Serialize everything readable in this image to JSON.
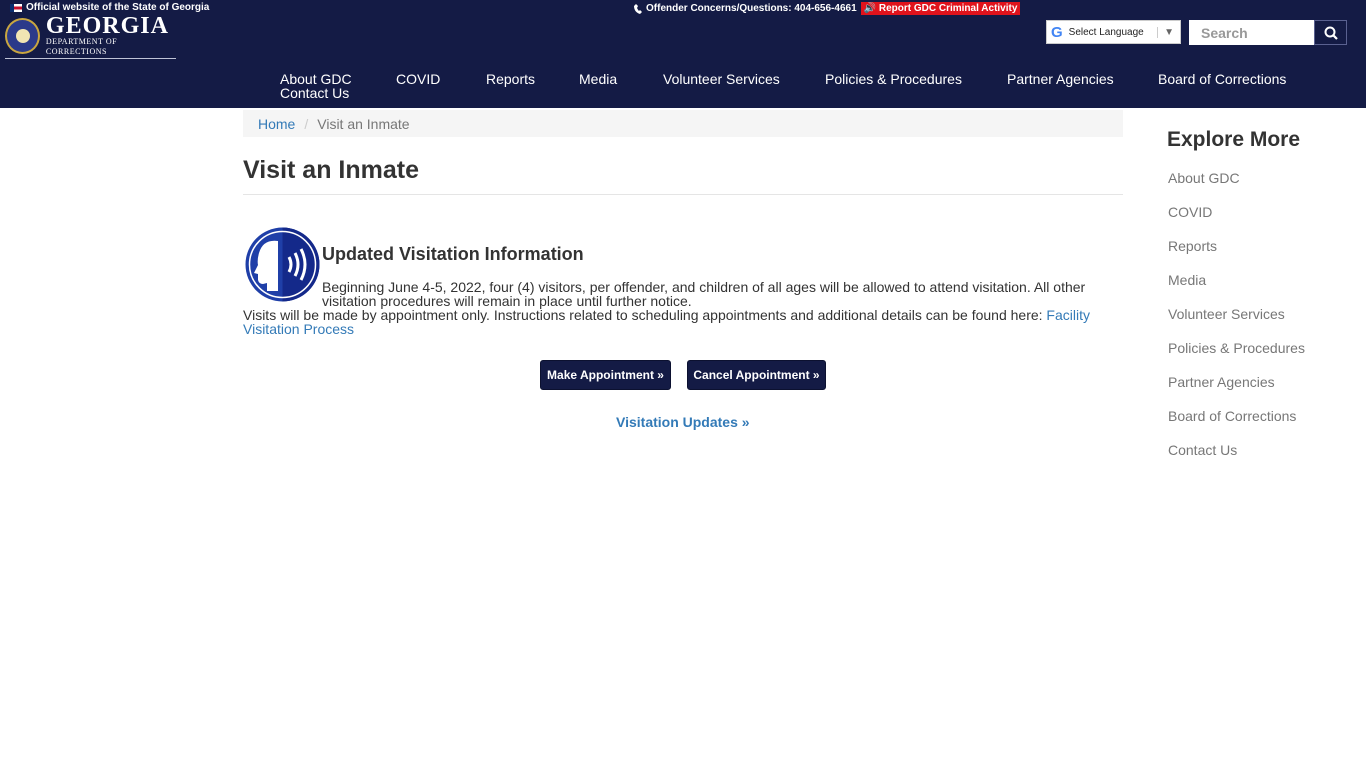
{
  "topbar": {
    "official_text": "Official website of the State of Georgia",
    "concerns_text": "Offender Concerns/Questions: 404-656-4661",
    "report_label": "Report GDC Criminal Activity"
  },
  "logo": {
    "main": "GEORGIA",
    "sub": "DEPARTMENT OF CORRECTIONS"
  },
  "translate": {
    "label": "Select Language",
    "google_glyph": "G"
  },
  "search": {
    "placeholder": "Search"
  },
  "nav": {
    "items": [
      "About GDC",
      "COVID",
      "Reports",
      "Media",
      "Volunteer Services",
      "Policies & Procedures",
      "Partner Agencies",
      "Board of Corrections",
      "Contact Us"
    ]
  },
  "breadcrumb": {
    "home": "Home",
    "separator": "/",
    "current": "Visit an Inmate"
  },
  "main": {
    "title": "Visit an Inmate",
    "section_title": "Updated Visitation Information",
    "paragraph1": "Beginning June 4-5, 2022, four (4) visitors, per offender, and children of all ages will be allowed to attend visitation. All other visitation procedures will remain in place until further notice.",
    "paragraph2_text": "Visits will be made by appointment only. Instructions related to scheduling appointments and additional details can be found here: ",
    "paragraph2_link": "Facility Visitation Process",
    "make_appointment": "Make Appointment »",
    "cancel_appointment": "Cancel Appointment »",
    "visitation_updates": "Visitation Updates »"
  },
  "sidebar": {
    "title": "Explore More",
    "items": [
      "About GDC",
      "COVID",
      "Reports",
      "Media",
      "Volunteer Services",
      "Policies & Procedures",
      "Partner Agencies",
      "Board of Corrections",
      "Contact Us"
    ]
  },
  "colors": {
    "header_bg": "#141b45",
    "link": "#337ab7",
    "report_red": "#e0131c"
  }
}
